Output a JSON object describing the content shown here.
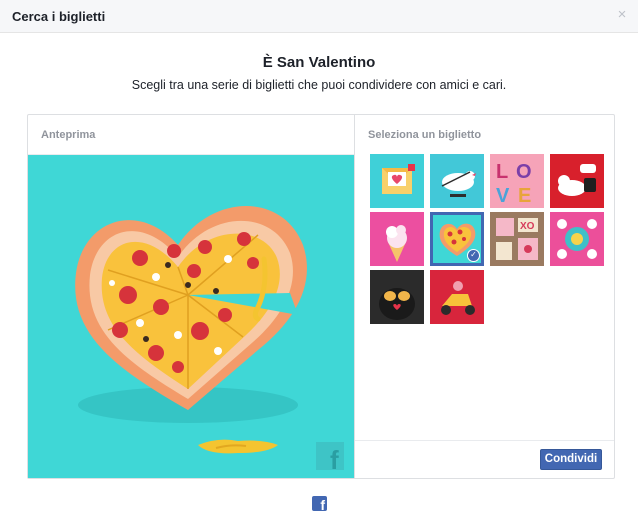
{
  "dialog": {
    "title": "Cerca i biglietti",
    "close_icon": "close-icon",
    "close_glyph": "×"
  },
  "intro": {
    "headline": "È San Valentino",
    "subheadline": "Scegli tra una serie di biglietti che puoi condividere con amici e cari."
  },
  "preview": {
    "label": "Anteprima",
    "image": "heart-shaped-pizza-card",
    "watermark_icon": "facebook-logo-icon"
  },
  "selector": {
    "label": "Seleziona un biglietto",
    "cards": [
      {
        "name": "card-envelope",
        "selected": false
      },
      {
        "name": "card-cupid-bird",
        "selected": false
      },
      {
        "name": "card-love-letters",
        "selected": false
      },
      {
        "name": "card-cat-phone",
        "selected": false
      },
      {
        "name": "card-ice-cream",
        "selected": false
      },
      {
        "name": "card-heart-pizza",
        "selected": true
      },
      {
        "name": "card-xo-stamps",
        "selected": false
      },
      {
        "name": "card-flowers",
        "selected": false
      },
      {
        "name": "card-gorillas",
        "selected": false
      },
      {
        "name": "card-scooter",
        "selected": false
      }
    ],
    "share_label": "Condividi"
  },
  "footer": {
    "logo_icon": "facebook-logo-icon",
    "logo_glyph": "f"
  },
  "colors": {
    "accent": "#4267b2",
    "preview_background": "#3fd7d6",
    "header_background": "#f6f7f9"
  }
}
